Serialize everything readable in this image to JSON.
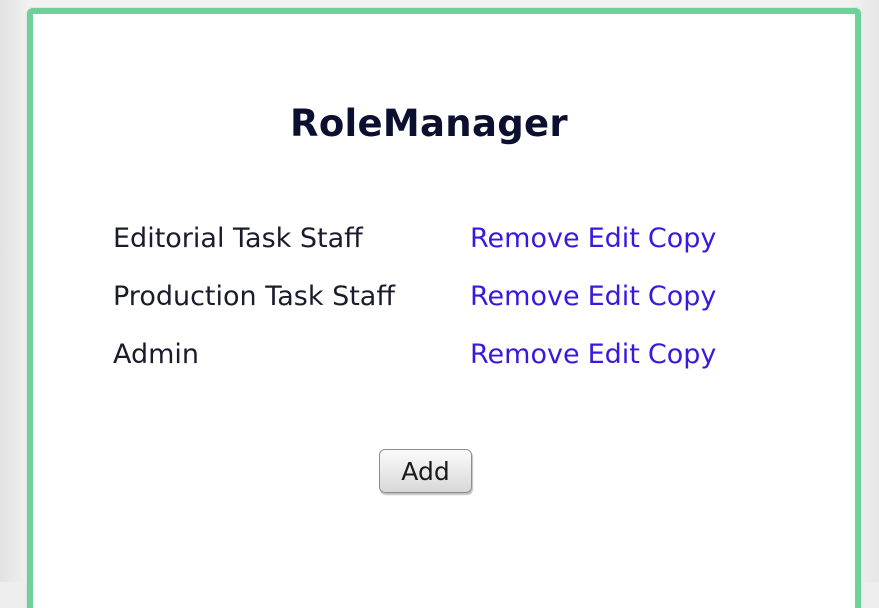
{
  "page": {
    "title": "RoleManager"
  },
  "roles": [
    {
      "name": "Editorial Task Staff",
      "actions": {
        "remove": "Remove",
        "edit": "Edit",
        "copy": "Copy"
      }
    },
    {
      "name": "Production Task Staff",
      "actions": {
        "remove": "Remove",
        "edit": "Edit",
        "copy": "Copy"
      }
    },
    {
      "name": "Admin",
      "actions": {
        "remove": "Remove",
        "edit": "Edit",
        "copy": "Copy"
      }
    }
  ],
  "add_button": {
    "label": "Add"
  },
  "colors": {
    "panel_border": "#6fd19a",
    "link": "#3b17e0",
    "title": "#0c1030",
    "text": "#1b1b2e"
  }
}
